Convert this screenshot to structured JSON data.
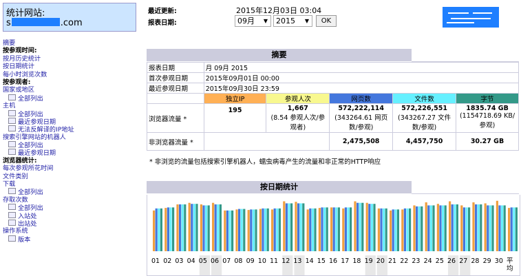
{
  "site": {
    "title": "统计网站:",
    "name_prefix": "s",
    "name_suffix": ".com"
  },
  "menu": [
    {
      "text": "摘要",
      "type": "link"
    },
    {
      "text": "按参观时间:",
      "type": "head"
    },
    {
      "text": "按月历史统计",
      "type": "link"
    },
    {
      "text": "按日期统计",
      "type": "link"
    },
    {
      "text": "每小时浏览次数",
      "type": "link"
    },
    {
      "text": "按参观者:",
      "type": "head"
    },
    {
      "text": "国家或地区",
      "type": "link"
    },
    {
      "text": "全部列出",
      "type": "sub"
    },
    {
      "text": "主机",
      "type": "link"
    },
    {
      "text": "全部列出",
      "type": "sub"
    },
    {
      "text": "最近参观日期",
      "type": "sub"
    },
    {
      "text": "无法反解译的IP地址",
      "type": "sub"
    },
    {
      "text": "搜索引擎网站的机器人",
      "type": "link"
    },
    {
      "text": "全部列出",
      "type": "sub"
    },
    {
      "text": "最近参观日期",
      "type": "sub"
    },
    {
      "text": "浏览器统计:",
      "type": "head"
    },
    {
      "text": "每次参观所花时间",
      "type": "link"
    },
    {
      "text": "文件类别",
      "type": "link"
    },
    {
      "text": "下载",
      "type": "link"
    },
    {
      "text": "全部列出",
      "type": "sub"
    },
    {
      "text": "存取次数",
      "type": "link"
    },
    {
      "text": "全部列出",
      "type": "sub"
    },
    {
      "text": "入站处",
      "type": "sub"
    },
    {
      "text": "出站处",
      "type": "sub"
    },
    {
      "text": "操作系统",
      "type": "link"
    },
    {
      "text": "版本",
      "type": "sub"
    }
  ],
  "top": {
    "last_update_label": "最近更新:",
    "last_update_value": "2015年12月03日 03:04",
    "report_date_label": "报表日期:",
    "month": "09月",
    "year": "2015",
    "ok": "OK"
  },
  "summary": {
    "heading": "摘要",
    "report_date_label": "报表日期",
    "report_date_value": "月 09月 2015",
    "first_visit_label": "首次参观日期",
    "first_visit_value": "2015年09月01日 00:00",
    "last_visit_label": "最近参观日期",
    "last_visit_value": "2015年09月30日 23:59",
    "columns": [
      "独立IP",
      "参观人次",
      "网页数",
      "文件数",
      "字节"
    ],
    "column_colors": [
      "#ffb055",
      "#f8f88f",
      "#4477dd",
      "#66f0ff",
      "#339988"
    ],
    "browser_label": "浏览器流量 *",
    "browser": {
      "unique_ip": "195",
      "visits": "1,667",
      "visits_sub": "(8.54 参观人次/参观者)",
      "pages": "572,222,114",
      "pages_sub": "(343264.61 网页数/参观)",
      "files": "572,226,551",
      "files_sub": "(343267.27 文件数/参观)",
      "bytes": "1835.74 GB",
      "bytes_sub": "(1154718.69 KB/参观)"
    },
    "nonbrowser_label": "非浏览器流量 *",
    "nonbrowser": {
      "pages": "2,475,508",
      "files": "4,457,750",
      "bytes": "30.27 GB"
    },
    "footnote": "* 非浏览的流量包括搜索引擎机器人，蠕虫病毒产生的流量和非正常的HTTP响应"
  },
  "daily": {
    "heading": "按日期统计",
    "days": [
      "01",
      "02",
      "03",
      "04",
      "05",
      "06",
      "07",
      "08",
      "09",
      "10",
      "11",
      "12",
      "13",
      "14",
      "15",
      "16",
      "17",
      "18",
      "19",
      "20",
      "21",
      "22",
      "23",
      "24",
      "25",
      "26",
      "27",
      "28",
      "29",
      "30"
    ],
    "avg_label": "平均"
  },
  "chart_data": {
    "type": "bar",
    "categories": [
      "01",
      "02",
      "03",
      "04",
      "05",
      "06",
      "07",
      "08",
      "09",
      "10",
      "11",
      "12",
      "13",
      "14",
      "15",
      "16",
      "17",
      "18",
      "19",
      "20",
      "21",
      "22",
      "23",
      "24",
      "25",
      "26",
      "27",
      "28",
      "29",
      "30",
      "平均"
    ],
    "series": [
      {
        "name": "参观人次",
        "color": "#f0a040",
        "values": [
          0.8,
          0.85,
          0.92,
          0.95,
          0.92,
          0.95,
          0.8,
          0.82,
          0.81,
          0.83,
          0.82,
          0.98,
          0.97,
          0.82,
          0.85,
          0.86,
          0.84,
          0.98,
          0.95,
          0.84,
          0.8,
          0.82,
          0.9,
          0.96,
          0.93,
          0.98,
          0.9,
          0.96,
          0.94,
          0.99,
          0.85
        ]
      },
      {
        "name": "网页数",
        "color": "#4477dd",
        "values": [
          0.84,
          0.86,
          0.92,
          0.93,
          0.9,
          0.92,
          0.8,
          0.83,
          0.82,
          0.84,
          0.84,
          0.94,
          0.94,
          0.84,
          0.86,
          0.86,
          0.86,
          0.95,
          0.93,
          0.84,
          0.82,
          0.84,
          0.88,
          0.9,
          0.9,
          0.92,
          0.86,
          0.92,
          0.9,
          0.9,
          0.86
        ]
      },
      {
        "name": "文件数",
        "color": "#66f0ff",
        "values": [
          0.84,
          0.86,
          0.92,
          0.93,
          0.9,
          0.92,
          0.8,
          0.83,
          0.82,
          0.84,
          0.84,
          0.94,
          0.94,
          0.84,
          0.86,
          0.86,
          0.86,
          0.95,
          0.93,
          0.84,
          0.82,
          0.84,
          0.88,
          0.9,
          0.9,
          0.92,
          0.86,
          0.92,
          0.9,
          0.9,
          0.86
        ]
      },
      {
        "name": "字节",
        "color": "#339988",
        "values": [
          0.84,
          0.86,
          0.92,
          0.93,
          0.9,
          0.92,
          0.8,
          0.83,
          0.82,
          0.84,
          0.84,
          0.94,
          0.94,
          0.84,
          0.86,
          0.86,
          0.86,
          0.95,
          0.93,
          0.84,
          0.82,
          0.84,
          0.88,
          0.9,
          0.9,
          0.92,
          0.86,
          0.92,
          0.9,
          0.9,
          0.86
        ]
      }
    ],
    "weekend_days": [
      "05",
      "06",
      "12",
      "13",
      "19",
      "20",
      "26",
      "27"
    ]
  }
}
